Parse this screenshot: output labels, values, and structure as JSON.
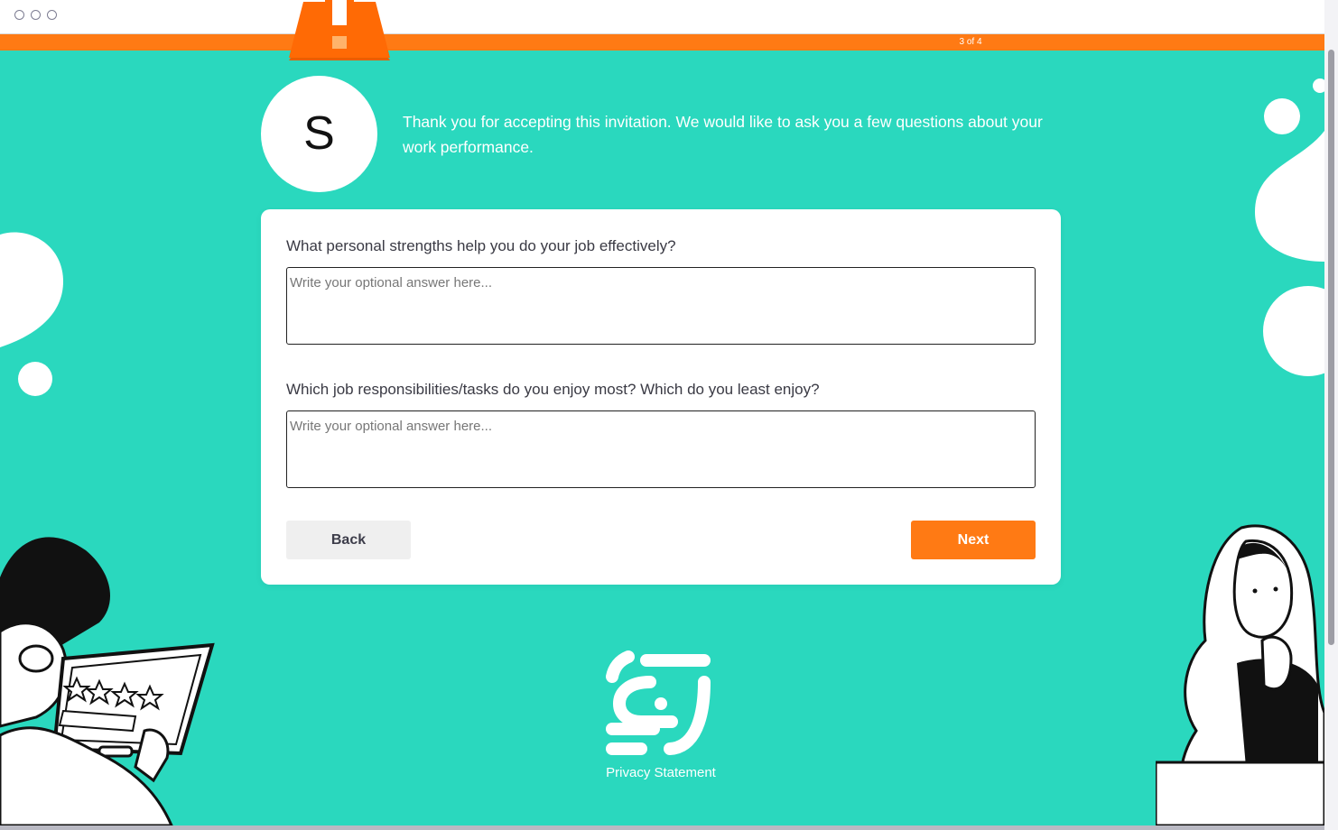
{
  "window": {
    "controls": [
      "circle-1",
      "circle-2",
      "circle-3"
    ]
  },
  "progress": {
    "label": "3 of 4",
    "value": 0.75,
    "color": "#ff7a14"
  },
  "header": {
    "avatar_letter": "S",
    "intro": "Thank you for accepting this invitation. We would like to ask you a few questions about your work performance."
  },
  "form": {
    "questions": [
      {
        "label": "What personal strengths help you do your job effectively?",
        "placeholder": "Write your optional answer here...",
        "value": ""
      },
      {
        "label": "Which job responsibilities/tasks do you enjoy most? Which do you least enjoy?",
        "placeholder": "Write your optional answer here...",
        "value": ""
      }
    ],
    "back_label": "Back",
    "next_label": "Next"
  },
  "footer": {
    "privacy_label": "Privacy Statement"
  },
  "colors": {
    "background": "#2ad8be",
    "accent": "#ff7a14",
    "card": "#ffffff"
  },
  "icons": [
    "warning-icon",
    "brand-logo-icon",
    "review-person-illustration",
    "thinking-woman-illustration"
  ]
}
